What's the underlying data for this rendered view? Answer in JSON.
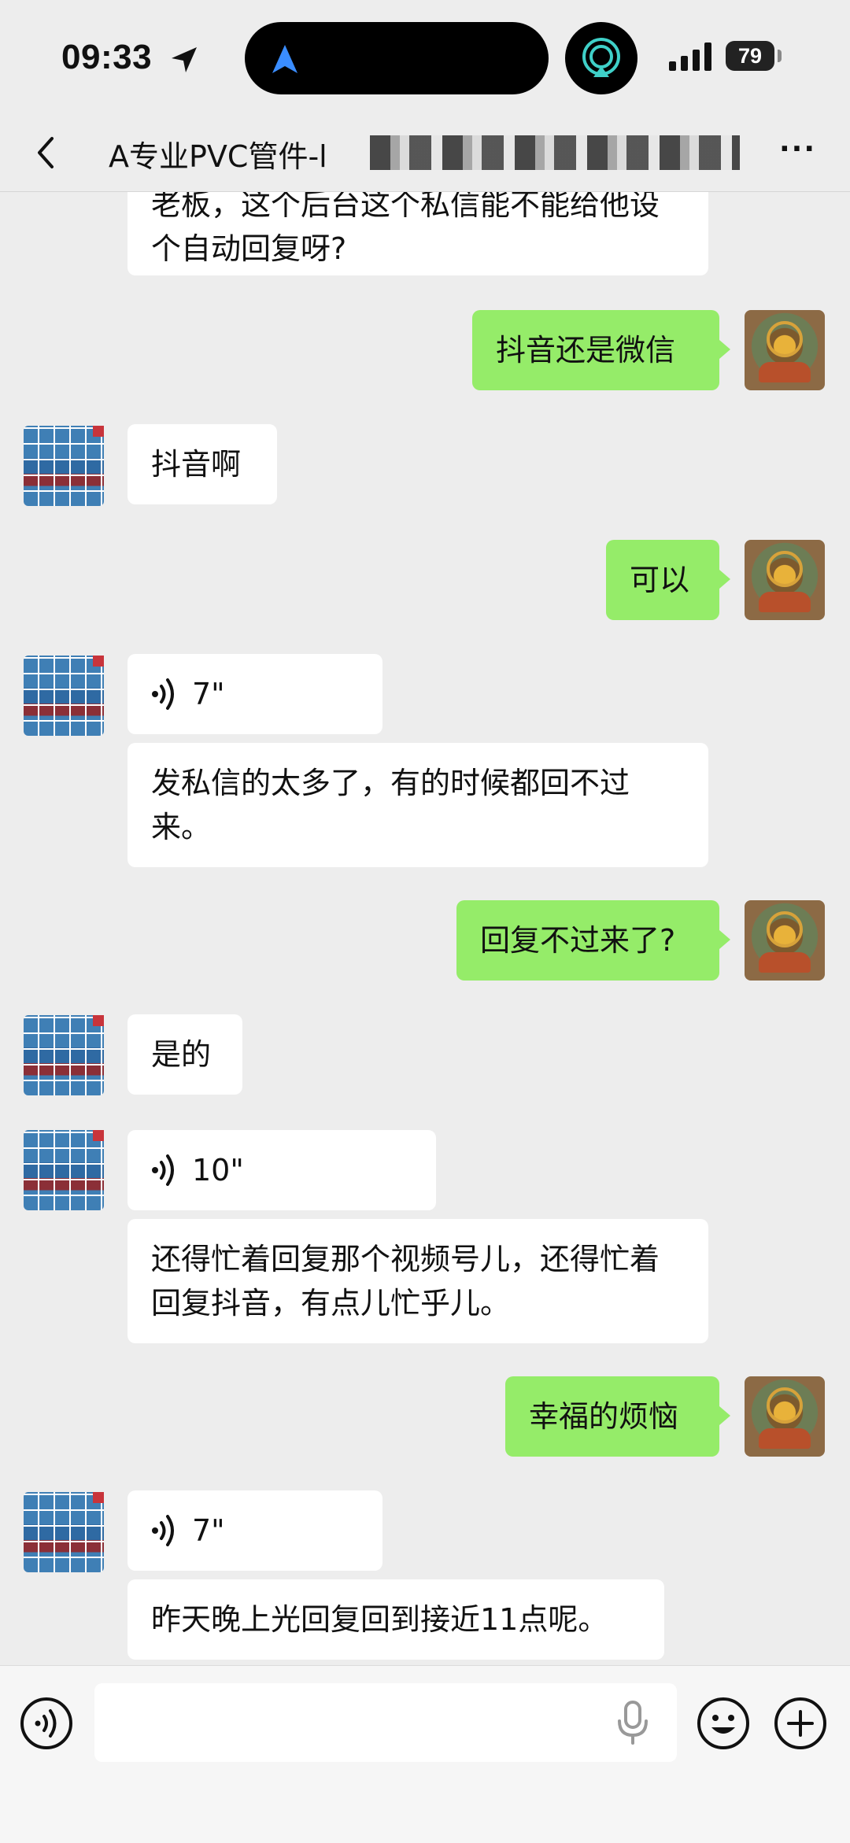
{
  "status_bar": {
    "time": "09:33",
    "battery": "79"
  },
  "nav": {
    "title": "A专业PVC管件-l"
  },
  "messages": [
    {
      "side": "in",
      "text": "老板，这个后台这个私信能不能给他设个自动回复呀?"
    },
    {
      "side": "out",
      "text": "抖音还是微信"
    },
    {
      "side": "in",
      "text": "抖音啊"
    },
    {
      "side": "out",
      "text": "可以"
    },
    {
      "side": "in",
      "type": "voice",
      "duration": "7\""
    },
    {
      "side": "in",
      "text": "发私信的太多了，有的时候都回不过来。"
    },
    {
      "side": "out",
      "text": "回复不过来了?"
    },
    {
      "side": "in",
      "text": "是的"
    },
    {
      "side": "in",
      "type": "voice",
      "duration": "10\""
    },
    {
      "side": "in",
      "text": "还得忙着回复那个视频号儿，还得忙着回复抖音，有点儿忙乎儿。"
    },
    {
      "side": "out",
      "text": "幸福的烦恼"
    },
    {
      "side": "in",
      "type": "voice",
      "duration": "7\""
    },
    {
      "side": "in",
      "text": "昨天晚上光回复回到接近11点呢。"
    }
  ],
  "icons": {
    "back": "chevron-left-icon",
    "more": "more-icon",
    "voice_toggle": "voice-icon",
    "mic": "microphone-icon",
    "emoji": "emoji-icon",
    "plus": "plus-icon"
  },
  "colors": {
    "outgoing_bubble": "#95ec69",
    "incoming_bubble": "#ffffff",
    "background": "#ededed"
  }
}
